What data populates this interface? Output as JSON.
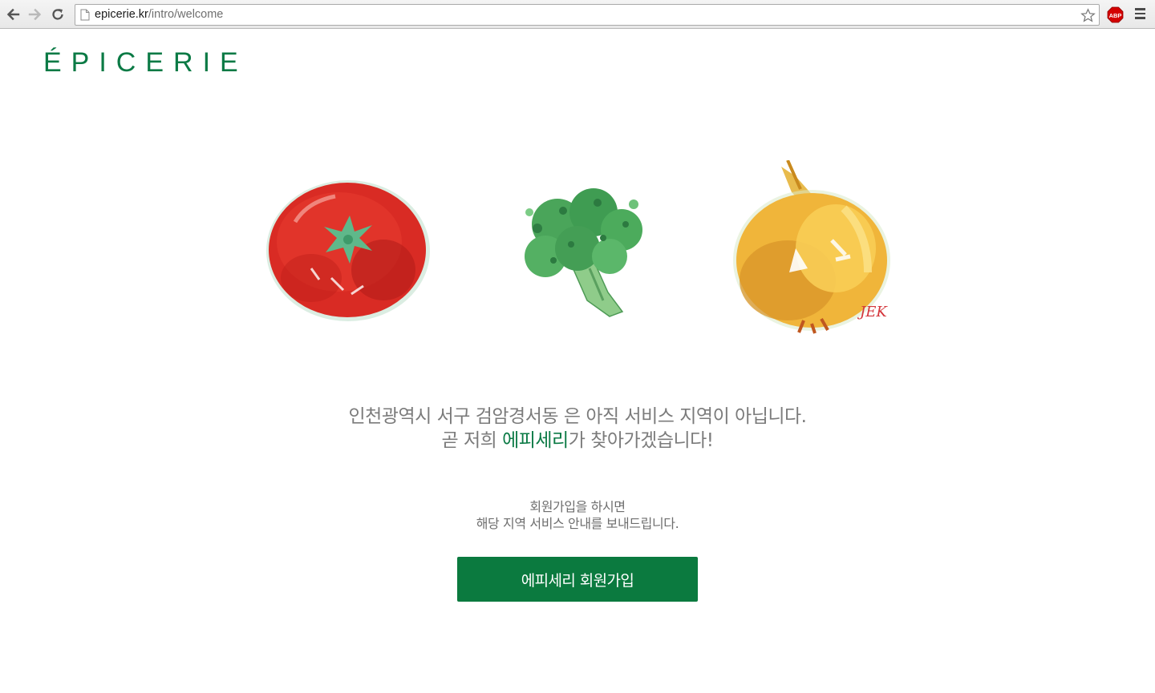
{
  "browser": {
    "url_host": "epicerie.kr",
    "url_path": "/intro/welcome",
    "icons": {
      "back": "arrow-left-icon",
      "forward": "arrow-right-icon",
      "reload": "reload-icon",
      "page": "page-icon",
      "bookmark": "star-icon",
      "adblock": "abp-icon",
      "menu": "hamburger-menu-icon"
    },
    "abp_label": "ABP"
  },
  "header": {
    "logo": "ÉPICERIE"
  },
  "illustrations": {
    "items": [
      "tomato",
      "broccoli",
      "onion"
    ],
    "signature": "JEK"
  },
  "main": {
    "line1": "인천광역시 서구 검암경서동 은 아직 서비스 지역이 아닙니다.",
    "line2_prefix": "곧 저희 ",
    "line2_brand": "에피세리",
    "line2_suffix": "가 찾아가겠습니다!",
    "sub_line1": "회원가입을 하시면",
    "sub_line2": "해당 지역 서비스 안내를 보내드립니다.",
    "cta_label": "에피세리 회원가입"
  },
  "colors": {
    "brand_green": "#0b7a45",
    "button_green": "#0b7a3f",
    "text_gray": "#7b7b7b"
  }
}
